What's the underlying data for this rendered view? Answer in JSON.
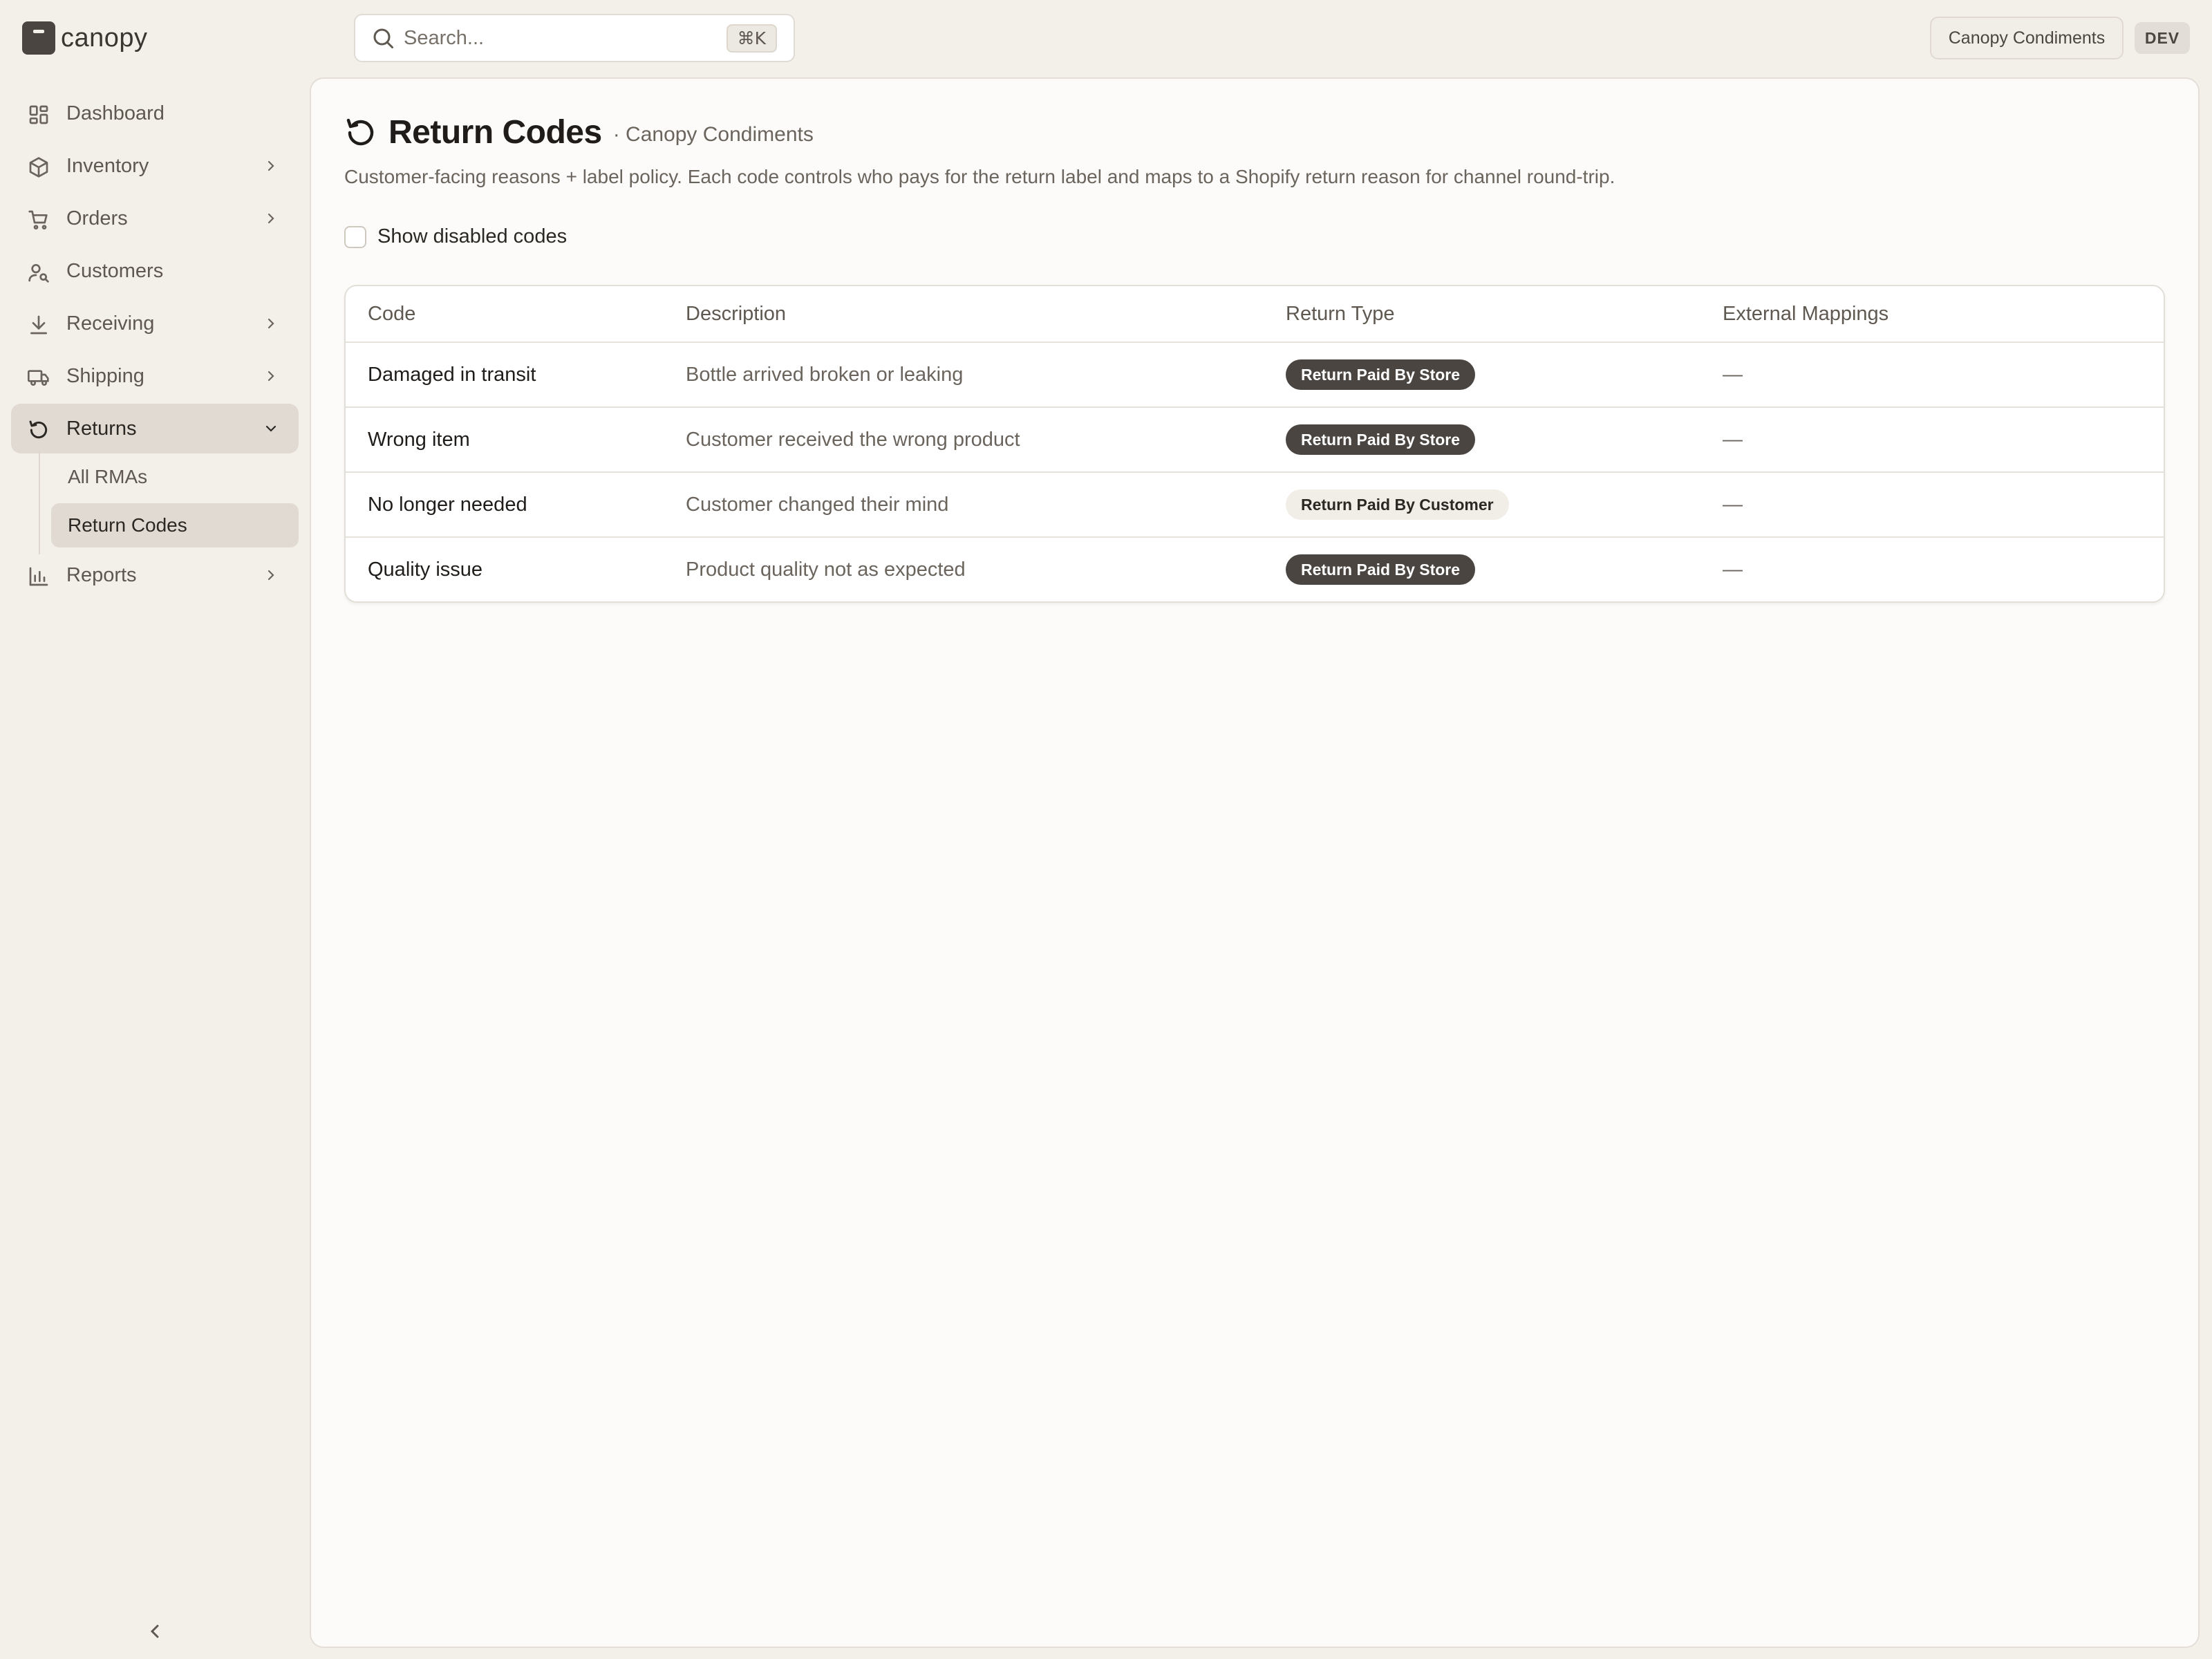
{
  "brand": {
    "name": "canopy"
  },
  "search": {
    "placeholder": "Search...",
    "shortcut": "⌘K"
  },
  "topbar": {
    "store": "Canopy Condiments",
    "env": "DEV"
  },
  "sidebar": {
    "items": [
      {
        "label": "Dashboard",
        "icon": "dashboard-icon"
      },
      {
        "label": "Inventory",
        "icon": "box-icon"
      },
      {
        "label": "Orders",
        "icon": "cart-icon"
      },
      {
        "label": "Customers",
        "icon": "user-search-icon"
      },
      {
        "label": "Receiving",
        "icon": "download-icon"
      },
      {
        "label": "Shipping",
        "icon": "truck-icon"
      },
      {
        "label": "Returns",
        "icon": "undo-icon"
      },
      {
        "label": "Reports",
        "icon": "bar-chart-icon"
      }
    ],
    "returns_sub": [
      {
        "label": "All RMAs"
      },
      {
        "label": "Return Codes"
      }
    ]
  },
  "page": {
    "title": "Return Codes",
    "subtitle": "· Canopy Condiments",
    "description": "Customer-facing reasons + label policy. Each code controls who pays for the return label and maps to a Shopify return reason for channel round-trip.",
    "toggle_label": "Show disabled codes"
  },
  "table": {
    "headers": [
      "Code",
      "Description",
      "Return Type",
      "External Mappings"
    ],
    "rows": [
      {
        "code": "Damaged in transit",
        "description": "Bottle arrived broken or leaking",
        "type": "Return Paid By Store",
        "mapping": "—"
      },
      {
        "code": "Wrong item",
        "description": "Customer received the wrong product",
        "type": "Return Paid By Store",
        "mapping": "—"
      },
      {
        "code": "No longer needed",
        "description": "Customer changed their mind",
        "type": "Return Paid By Customer",
        "mapping": "—"
      },
      {
        "code": "Quality issue",
        "description": "Product quality not as expected",
        "type": "Return Paid By Store",
        "mapping": "—"
      }
    ]
  },
  "colors": {
    "accent": "#4a4540",
    "background": "#f3efe9",
    "panel": "#fcfbf9"
  }
}
